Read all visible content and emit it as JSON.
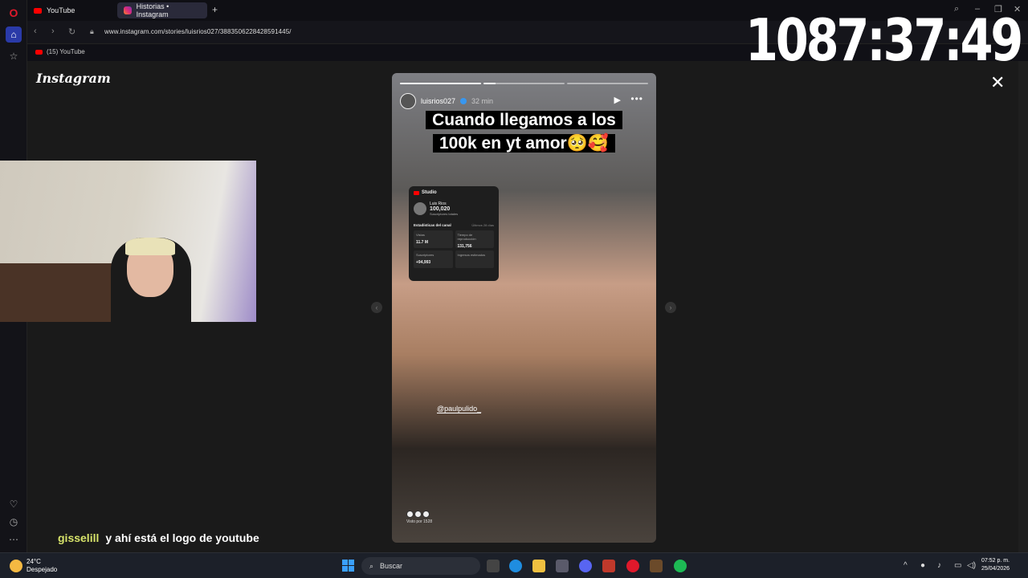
{
  "browser": {
    "tabs": [
      {
        "label": "YouTube",
        "icon": "youtube-icon"
      },
      {
        "label": "Historias • Instagram",
        "icon": "instagram-icon"
      }
    ],
    "url": "www.instagram.com/stories/luisrios027/3883506228428591445/",
    "bookmark": {
      "label": "(15) YouTube",
      "icon": "youtube-icon"
    }
  },
  "timer": "1087:37:49",
  "instagram": {
    "logo": "Instagram",
    "story": {
      "username": "luisrios027",
      "time": "32 min",
      "caption": "Cuando llegamos a los 100k en yt amor🥺🥰",
      "mention": "@paulpulido_",
      "viewers_text": "Visto por 1528",
      "progress_segments": 3,
      "progress_current": 2,
      "studio": {
        "title": "Studio",
        "channel_name": "Luis Rios",
        "subscribers": "100,020",
        "subscribers_label": "Suscriptores totales",
        "section": "Estadísticas del canal",
        "section_range": "Últimos 28 días",
        "stats": [
          {
            "label": "Vistas",
            "value": "11.7 M"
          },
          {
            "label": "Tiempo de reproducción",
            "value": "131,756"
          },
          {
            "label": "Suscriptores",
            "value": "+94,993"
          },
          {
            "label": "Ingresos estimados",
            "value": ""
          }
        ]
      }
    }
  },
  "chat": {
    "user": "gisselill",
    "message": "y ahí está el logo de youtube"
  },
  "taskbar": {
    "weather_temp": "24°C",
    "weather_desc": "Despejado",
    "search_placeholder": "Buscar",
    "time": "07:52 p. m.",
    "date": "25/04/2026"
  },
  "colors": {
    "opera_red": "#e0192b",
    "youtube_red": "#ff0000",
    "chat_user": "#d7e36a",
    "home_active": "#2a3aa8"
  }
}
